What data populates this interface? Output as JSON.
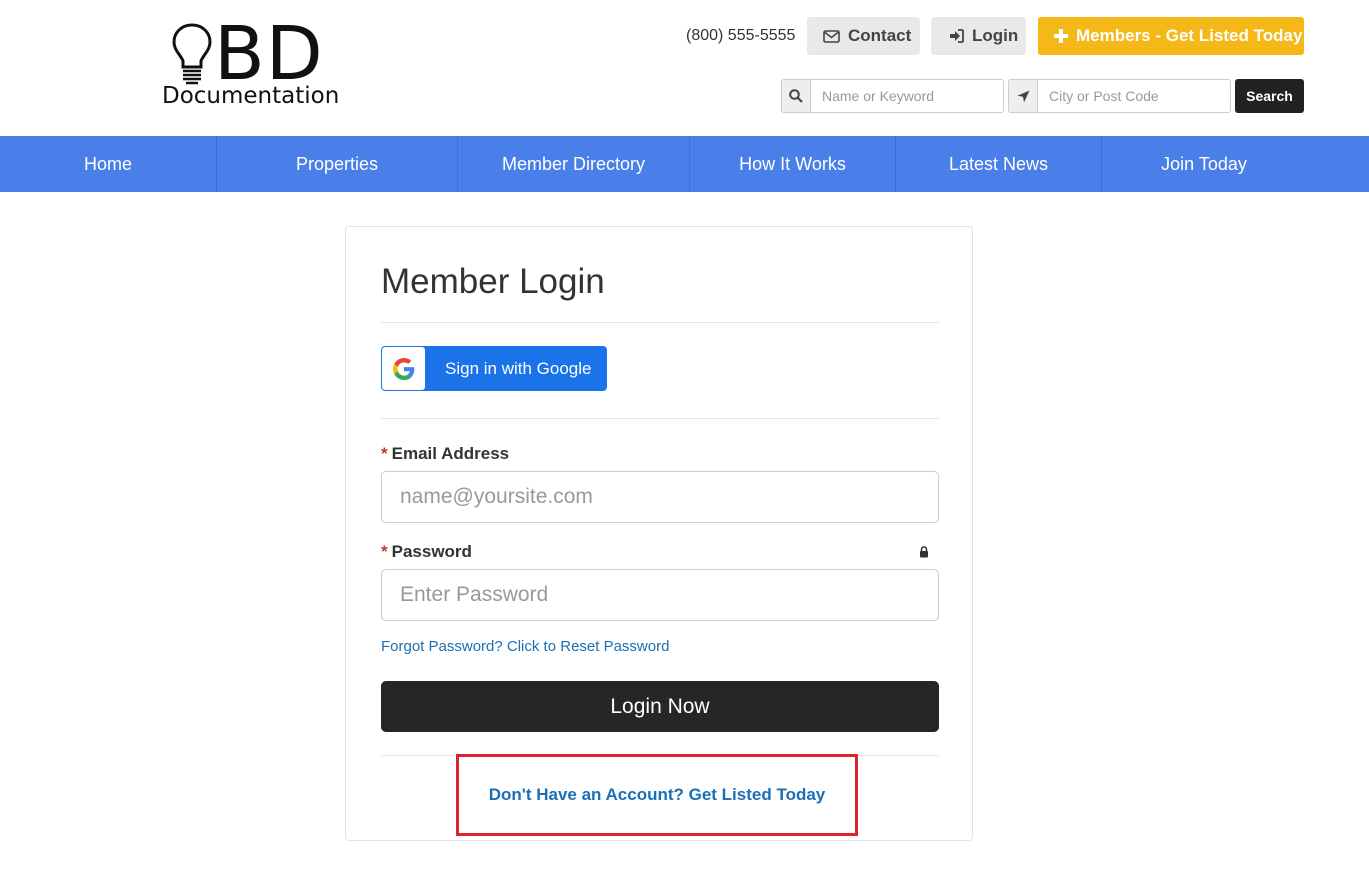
{
  "brand": {
    "logo_text": "BD",
    "logo_subtitle": "Documentation"
  },
  "header": {
    "phone": "(800) 555-5555",
    "contact_label": "Contact",
    "login_label": "Login",
    "members_label": "Members - Get Listed Today",
    "keyword_placeholder": "Name or Keyword",
    "location_placeholder": "City or Post Code",
    "search_label": "Search"
  },
  "nav": {
    "items": [
      {
        "label": "Home"
      },
      {
        "label": "Properties"
      },
      {
        "label": "Member Directory"
      },
      {
        "label": "How It Works"
      },
      {
        "label": "Latest News"
      },
      {
        "label": "Join Today"
      }
    ]
  },
  "login": {
    "title": "Member Login",
    "google_label": "Sign in with Google",
    "email_label": "Email Address",
    "email_placeholder": "name@yoursite.com",
    "password_label": "Password",
    "password_placeholder": "Enter Password",
    "required_mark": "*",
    "forgot_link": "Forgot Password? Click to Reset Password",
    "submit_label": "Login Now",
    "signup_link": "Don't Have an Account? Get Listed Today"
  },
  "colors": {
    "nav_bg": "#4a7fe9",
    "members_btn": "#f5b819",
    "google_btn": "#1a73e8",
    "login_btn": "#262626",
    "link": "#1a6fb5",
    "highlight_border": "#d9262e"
  },
  "icons": {
    "contact": "envelope-icon",
    "login": "sign-in-icon",
    "members": "plus-icon",
    "keyword": "search-icon",
    "location": "location-arrow-icon",
    "password": "lock-icon",
    "google": "google-logo-icon",
    "logo": "lightbulb-icon"
  }
}
